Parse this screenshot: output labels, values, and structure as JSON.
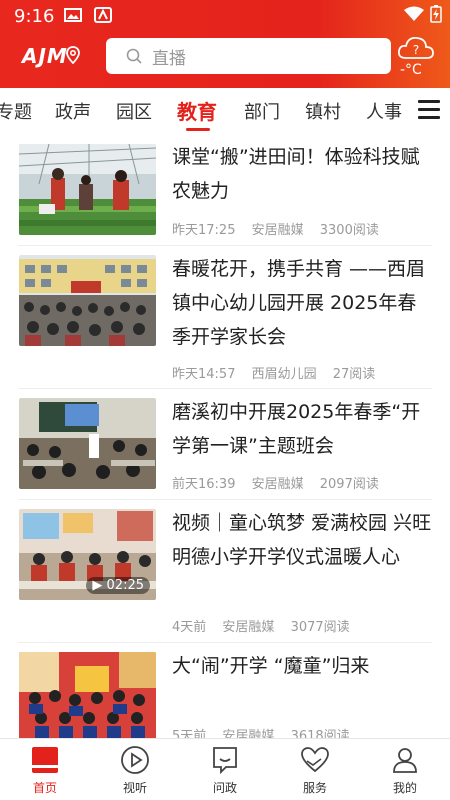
{
  "status_bar": {
    "time": "9:16"
  },
  "header": {
    "logo_text": "AJM",
    "search_placeholder": "直播",
    "weather_temp": "-°C",
    "weather_icon": "cloud-question-icon"
  },
  "tabs": [
    {
      "label": "专题"
    },
    {
      "label": "政声"
    },
    {
      "label": "园区"
    },
    {
      "label": "教育",
      "active": true
    },
    {
      "label": "部门"
    },
    {
      "label": "镇村"
    },
    {
      "label": "人事"
    }
  ],
  "articles": [
    {
      "title": "课堂“搬”进田间！体验科技赋农魅力",
      "time": "昨天17:25",
      "source": "安居融媒",
      "reads": "3300阅读"
    },
    {
      "title": "春暖花开，携手共育 ——西眉镇中心幼儿园开展 2025年春季开学家长会",
      "time": "昨天14:57",
      "source": "西眉幼儿园",
      "reads": "27阅读"
    },
    {
      "title": "磨溪初中开展2025年春季“开学第一课”主题班会",
      "time": "前天16:39",
      "source": "安居融媒",
      "reads": "2097阅读"
    },
    {
      "title": "视频｜童心筑梦 爱满校园 兴旺明德小学开学仪式温暖人心",
      "time": "4天前",
      "source": "安居融媒",
      "reads": "3077阅读",
      "video_duration": "02:25"
    },
    {
      "title": "大“闹”开学 “魔童”归来",
      "time": "5天前",
      "source": "安居融媒",
      "reads": "3618阅读"
    }
  ],
  "bottom_nav": [
    {
      "label": "首页",
      "icon": "home-icon",
      "active": true
    },
    {
      "label": "视听",
      "icon": "play-icon"
    },
    {
      "label": "问政",
      "icon": "chat-icon"
    },
    {
      "label": "服务",
      "icon": "heart-hands-icon"
    },
    {
      "label": "我的",
      "icon": "user-icon"
    }
  ],
  "colors": {
    "brand_red": "#e3231b",
    "meta_gray": "#9a9a9a"
  }
}
